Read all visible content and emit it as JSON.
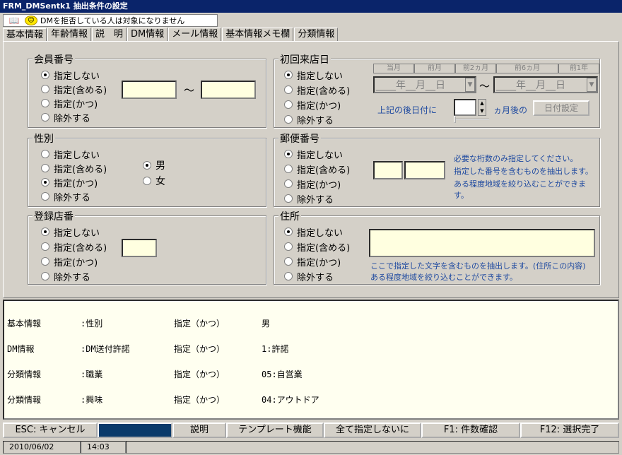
{
  "window": {
    "title": "FRM_DMSentk1 抽出条件の設定"
  },
  "notice": {
    "text": "DMを拒否している人は対象になりません"
  },
  "tabs": [
    "基本情報",
    "年齢情報",
    "説　明",
    "DM情報",
    "メール情報",
    "基本情報メモ欄",
    "分類情報"
  ],
  "radio_options": [
    "指定しない",
    "指定(含める)",
    "指定(かつ)",
    "除外する"
  ],
  "groups": {
    "member_no": {
      "title": "会員番号",
      "selected": 0,
      "tilde": "～"
    },
    "first_visit": {
      "title": "初回来店日",
      "selected": 0,
      "headers": [
        "当月",
        "前月",
        "前2ヵ月",
        "前6ヵ月",
        "前1年"
      ],
      "date_from": "____年__月__日",
      "date_to": "____年__月__日",
      "tilde": "～",
      "later_label": "上記の後日付に",
      "months_after": "ヵ月後の",
      "set_date_button": "日付設定"
    },
    "gender": {
      "title": "性別",
      "selected": 2,
      "male": "男",
      "female": "女",
      "gender_selected": "male"
    },
    "postal": {
      "title": "郵便番号",
      "selected": 0,
      "note": [
        "必要な桁数のみ指定してください。",
        "指定した番号を含むものを抽出します。",
        "ある程度地域を絞り込むことができます。"
      ]
    },
    "store": {
      "title": "登録店番",
      "selected": 0
    },
    "address": {
      "title": "住所",
      "selected": 0,
      "note": [
        "ここで指定した文字を含むものを抽出します。(住所この内容)",
        "ある程度地域を絞り込むことができます。"
      ]
    }
  },
  "output_rows": [
    [
      "基本情報",
      ":性別",
      "指定（かつ）",
      "男"
    ],
    [
      "DM情報",
      ":DM送付許諾",
      "指定（かつ）",
      "1:許諾"
    ],
    [
      "分類情報",
      ":職業",
      "指定（かつ）",
      "05:自営業"
    ],
    [
      "分類情報",
      ":興味",
      "指定（かつ）",
      "04:アウトドア"
    ]
  ],
  "fkeys": [
    "ESC: キャンセル",
    "",
    "説明",
    "テンプレート機能",
    "全て指定しないに",
    "F1: 件数確認",
    "F12: 選択完了"
  ],
  "status": {
    "date": "2010/06/02",
    "time": "14:03"
  }
}
